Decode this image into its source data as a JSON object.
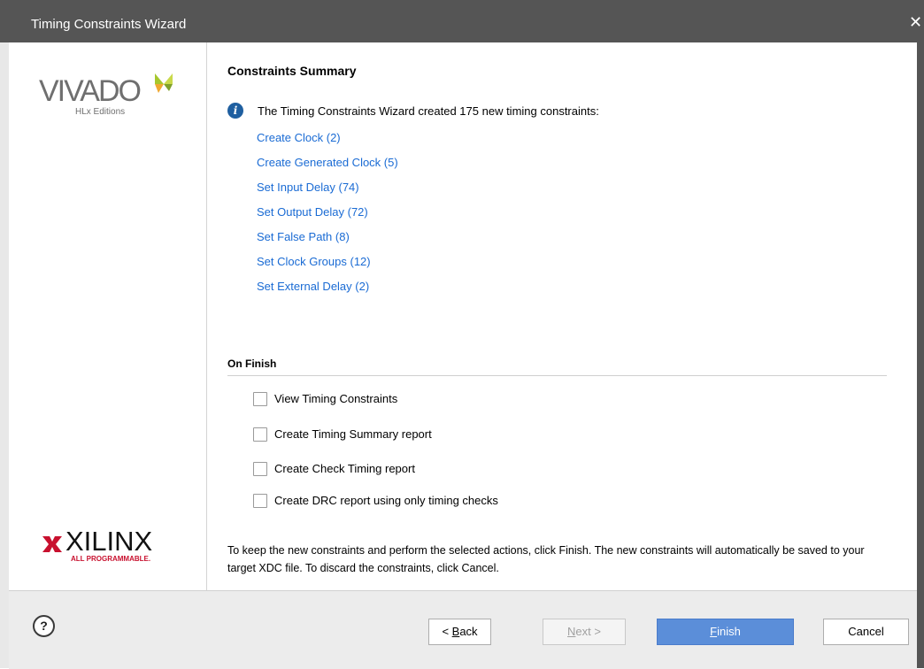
{
  "window": {
    "title": "Timing Constraints Wizard",
    "close_icon": "close-icon"
  },
  "sidebar": {
    "vivado_logo": {
      "name": "VIVADO",
      "sub": "HLx Editions"
    },
    "xilinx_logo": {
      "name": "XILINX",
      "sub": "ALL PROGRAMMABLE."
    }
  },
  "summary": {
    "heading": "Constraints Summary",
    "info_text": "The Timing Constraints Wizard created 175 new timing constraints:",
    "links": [
      "Create Clock (2)",
      "Create Generated Clock (5)",
      "Set Input Delay (74)",
      "Set Output Delay (72)",
      "Set False Path (8)",
      "Set Clock Groups (12)",
      "Set External Delay (2)"
    ]
  },
  "on_finish": {
    "label": "On Finish",
    "options": [
      {
        "label": "View Timing Constraints",
        "checked": false
      },
      {
        "label": "Create Timing Summary report",
        "checked": false
      },
      {
        "label": "Create Check Timing report",
        "checked": false
      },
      {
        "label": "Create DRC report using only timing checks",
        "checked": false
      }
    ]
  },
  "note": "To keep the new constraints and perform the selected actions, click Finish. The new constraints will automatically be saved to your target XDC file. To discard the constraints, click Cancel.",
  "footer": {
    "help": "?",
    "back": {
      "prefix": "< ",
      "mnemonic": "B",
      "rest": "ack"
    },
    "next": {
      "mnemonic": "N",
      "rest": "ext >",
      "enabled": false
    },
    "finish": {
      "mnemonic": "F",
      "rest": "inish"
    },
    "cancel": "Cancel"
  },
  "colors": {
    "titlebar": "#555555",
    "link": "#1a6bd4",
    "primary_button": "#5b8ed9",
    "info_icon": "#1f5fa0",
    "xilinx_red": "#c8102e",
    "vivado_accent": "#a6c72d"
  }
}
